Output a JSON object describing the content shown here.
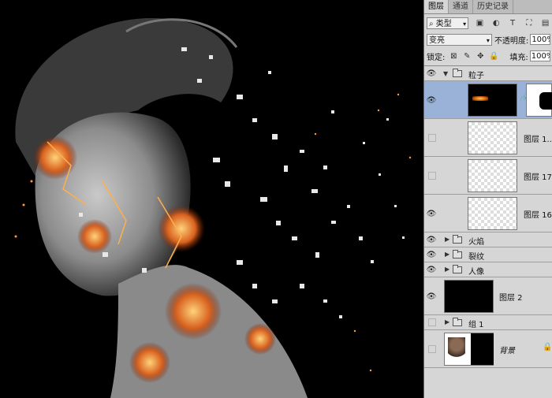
{
  "tabs": [
    "图层",
    "通道",
    "历史记录"
  ],
  "filter": {
    "label": "类型",
    "icons": [
      "image-filter-icon",
      "adjust-filter-icon",
      "type-filter-icon",
      "shape-filter-icon",
      "smart-filter-icon"
    ]
  },
  "blend": {
    "mode": "变亮",
    "opacity_label": "不透明度:",
    "opacity": "100%"
  },
  "lock": {
    "label": "锁定:",
    "fill_label": "填充:",
    "fill": "100%"
  },
  "layers": [
    {
      "name": "粒子",
      "kind": "group-open",
      "visible": true
    },
    {
      "name": "",
      "kind": "masked",
      "visible": true,
      "selected": true
    },
    {
      "name": "图层 1...",
      "kind": "transparent",
      "visible": false
    },
    {
      "name": "图层 17",
      "kind": "transparent",
      "visible": false
    },
    {
      "name": "图层 16",
      "kind": "transparent",
      "visible": true
    },
    {
      "name": "火焰",
      "kind": "group",
      "visible": true
    },
    {
      "name": "裂纹",
      "kind": "group",
      "visible": true
    },
    {
      "name": "人像",
      "kind": "group",
      "visible": true
    },
    {
      "name": "图层 2",
      "kind": "black",
      "visible": true
    },
    {
      "name": "组 1",
      "kind": "group",
      "visible": false
    },
    {
      "name": "背景",
      "kind": "background",
      "visible": false
    }
  ]
}
